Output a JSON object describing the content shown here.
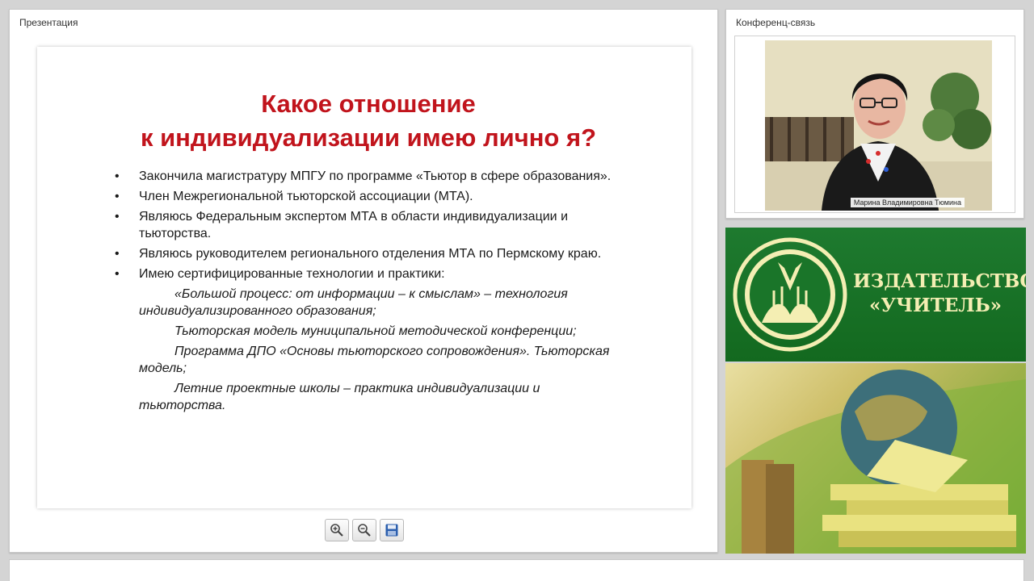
{
  "panels": {
    "presentation_title": "Презентация",
    "conference_title": "Конференц-связь"
  },
  "slide": {
    "title": "Какое отношение\nк индивидуализации имею лично я?",
    "bullets": [
      "Закончила магистратуру МПГУ по программе «Тьютор в сфере образования».",
      "Член Межрегиональной тьюторской ассоциации (МТА).",
      "Являюсь Федеральным экспертом МТА в области индивидуализации и тьюторства.",
      "Являюсь руководителем регионального отделения МТА по Пермскому краю.",
      "Имею сертифицированные технологии и практики:"
    ],
    "subitems": [
      "«Большой процесс: от информации – к смыслам» – технология индивидуализированного образования;",
      "Тьюторская модель муниципальной методической конференции;",
      "Программа ДПО «Основы тьюторского сопровождения». Тьюторская модель;",
      "Летние проектные школы – практика индивидуализации и тьюторства."
    ]
  },
  "toolbar": {
    "zoom_in_icon": "zoom-in-icon",
    "zoom_out_icon": "zoom-out-icon",
    "save_icon": "floppy-disk-icon"
  },
  "video": {
    "participant_name": "Марина Владимировна Тюмина"
  },
  "publisher": {
    "name": "ИЗДАТЕЛЬСТВО\n«УЧИТЕЛЬ»",
    "colors": {
      "green": "#1a7529",
      "gold": "#f4eeb3"
    }
  },
  "colors": {
    "slide_title": "#c1141c",
    "background": "#d4d4d4"
  }
}
